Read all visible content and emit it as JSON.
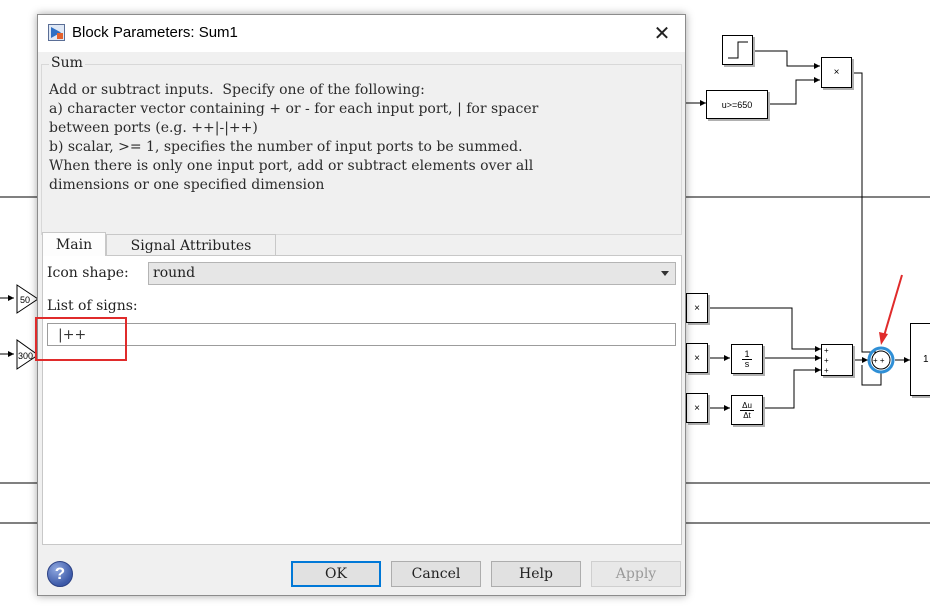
{
  "dialog": {
    "title": "Block Parameters: Sum1",
    "close_label": "✕",
    "block_type": "Sum",
    "description": "Add or subtract inputs.  Specify one of the following:\na) character vector containing + or - for each input port, | for spacer\nbetween ports (e.g. ++|-|++)\nb) scalar, >= 1, specifies the number of input ports to be summed.\nWhen there is only one input port, add or subtract elements over all\ndimensions or one specified dimension",
    "tabs": [
      {
        "label": "Main",
        "active": true
      },
      {
        "label": "Signal Attributes",
        "active": false
      }
    ],
    "icon_shape_label": "Icon shape:",
    "icon_shape_value": "round",
    "list_of_signs_label": "List of signs:",
    "list_of_signs_value": "|++",
    "buttons": {
      "help_icon": "?",
      "ok": "OK",
      "cancel": "Cancel",
      "help": "Help",
      "apply": "Apply"
    },
    "highlight_color": "#e02b2b",
    "focus_color": "#0078d7"
  },
  "canvas": {
    "blocks": {
      "relational": "u>=650",
      "product_top": "×",
      "product_1": "×",
      "product_2": "×",
      "product_3": "×",
      "gain_1": "50",
      "gain_2": "300",
      "integrator_num": "1",
      "integrator_den": "s",
      "derivative_num": "Δu",
      "derivative_den": "Δt",
      "sum_signs": [
        "+",
        "+",
        "+"
      ],
      "sum_round_signs": "+ +",
      "partial_block": "1"
    },
    "highlight_arrow_color": "#e02b2b",
    "selection_color": "#2f8fd6"
  }
}
